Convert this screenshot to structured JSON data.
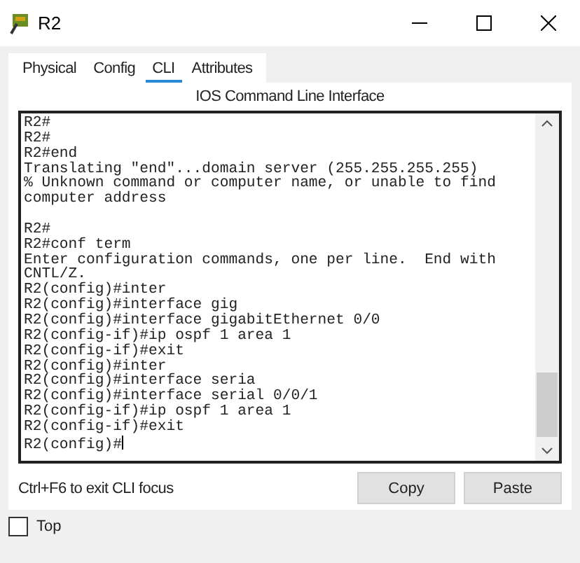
{
  "window": {
    "title": "R2"
  },
  "tabs": [
    {
      "label": "Physical",
      "selected": false
    },
    {
      "label": "Config",
      "selected": false
    },
    {
      "label": "CLI",
      "selected": true
    },
    {
      "label": "Attributes",
      "selected": false
    }
  ],
  "cli": {
    "heading": "IOS Command Line Interface",
    "blocks": [
      [
        "R2#",
        "R2#",
        "R2#end",
        "Translating \"end\"...domain server (255.255.255.255)",
        "% Unknown command or computer name, or unable to find",
        "computer address"
      ],
      [
        "R2#",
        "R2#conf term",
        "Enter configuration commands, one per line.  End with",
        "CNTL/Z.",
        "R2(config)#inter",
        "R2(config)#interface gig",
        "R2(config)#interface gigabitEthernet 0/0",
        "R2(config-if)#ip ospf 1 area 1",
        "R2(config-if)#exit",
        "R2(config)#inter",
        "R2(config)#interface seria",
        "R2(config)#interface serial 0/0/1",
        "R2(config-if)#ip ospf 1 area 1",
        "R2(config-if)#exit",
        "R2(config)#"
      ]
    ],
    "cursor": true,
    "hint": "Ctrl+F6 to exit CLI focus",
    "buttons": [
      "Copy",
      "Paste"
    ]
  },
  "top": {
    "label": "Top",
    "checked": false
  }
}
